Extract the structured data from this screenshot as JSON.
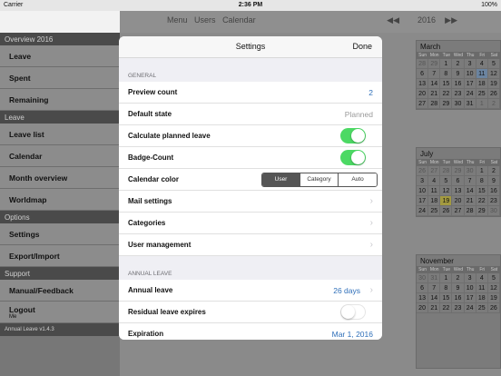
{
  "status_bar": {
    "carrier": "Carrier",
    "time": "2:36 PM",
    "battery": "100%"
  },
  "sidebar": {
    "sections": [
      {
        "title": "Overview 2016",
        "items": [
          {
            "label": "Leave"
          },
          {
            "label": "Spent"
          },
          {
            "label": "Remaining"
          }
        ]
      },
      {
        "title": "Leave",
        "items": [
          {
            "label": "Leave list"
          },
          {
            "label": "Calendar"
          },
          {
            "label": "Month overview"
          },
          {
            "label": "Worldmap"
          }
        ]
      },
      {
        "title": "Options",
        "items": [
          {
            "label": "Settings"
          },
          {
            "label": "Export/Import"
          }
        ]
      },
      {
        "title": "Support",
        "items": [
          {
            "label": "Manual/Feedback"
          },
          {
            "label": "Logout",
            "sub": "Me"
          }
        ]
      }
    ],
    "version": "Annual Leave v1.4.3"
  },
  "topbar": {
    "nav": [
      "Menu",
      "Users",
      "Calendar"
    ],
    "year": "2016",
    "prev_icon": "◀◀",
    "next_icon": "▶▶"
  },
  "calendar": {
    "dow_labels": [
      "Sun",
      "Mon",
      "Tue",
      "Wed",
      "Thu",
      "Fri",
      "Sat"
    ],
    "months": [
      {
        "name": "March",
        "days": [
          "28",
          "29",
          "1",
          "2",
          "3",
          "4",
          "5",
          "6",
          "7",
          "8",
          "9",
          "10",
          "11",
          "12",
          "13",
          "14",
          "15",
          "16",
          "17",
          "18",
          "19",
          "20",
          "21",
          "22",
          "23",
          "24",
          "25",
          "26",
          "27",
          "28",
          "29",
          "30",
          "31",
          "1",
          "2"
        ]
      },
      {
        "name": "July",
        "days": [
          "26",
          "27",
          "28",
          "29",
          "30",
          "1",
          "2",
          "3",
          "4",
          "5",
          "6",
          "7",
          "8",
          "9",
          "10",
          "11",
          "12",
          "13",
          "14",
          "15",
          "16",
          "17",
          "18",
          "19",
          "20",
          "21",
          "22",
          "23",
          "24",
          "25",
          "26",
          "27",
          "28",
          "29",
          "30"
        ]
      },
      {
        "name": "November",
        "days": [
          "30",
          "31",
          "1",
          "2",
          "3",
          "4",
          "5",
          "6",
          "7",
          "8",
          "9",
          "10",
          "11",
          "12",
          "13",
          "14",
          "15",
          "16",
          "17",
          "18",
          "19",
          "20",
          "21",
          "22",
          "23",
          "24",
          "25",
          "26"
        ]
      }
    ],
    "bg_day_columns": [
      "11",
      "18",
      "25",
      "1",
      "15",
      "22",
      "29",
      "5",
      "12",
      "19",
      "26",
      "3"
    ]
  },
  "modal": {
    "title": "Settings",
    "done_label": "Done",
    "general_label": "GENERAL",
    "rows": {
      "preview_count": {
        "label": "Preview count",
        "value": "2"
      },
      "default_state": {
        "label": "Default state",
        "value": "Planned"
      },
      "calc_planned": {
        "label": "Calculate planned leave",
        "on": true
      },
      "badge_count": {
        "label": "Badge-Count",
        "on": true
      },
      "calendar_color": {
        "label": "Calendar color",
        "options": [
          "User",
          "Category",
          "Auto"
        ],
        "selected": "User"
      },
      "mail_settings": {
        "label": "Mail settings"
      },
      "categories": {
        "label": "Categories"
      },
      "user_management": {
        "label": "User management"
      }
    },
    "annual_leave_label": "ANNUAL LEAVE",
    "annual_rows": {
      "annual_leave": {
        "label": "Annual leave",
        "value": "26 days"
      },
      "residual_expires": {
        "label": "Residual leave expires",
        "on": false
      },
      "expiration": {
        "label": "Expiration",
        "value": "Mar 1, 2016"
      }
    }
  }
}
